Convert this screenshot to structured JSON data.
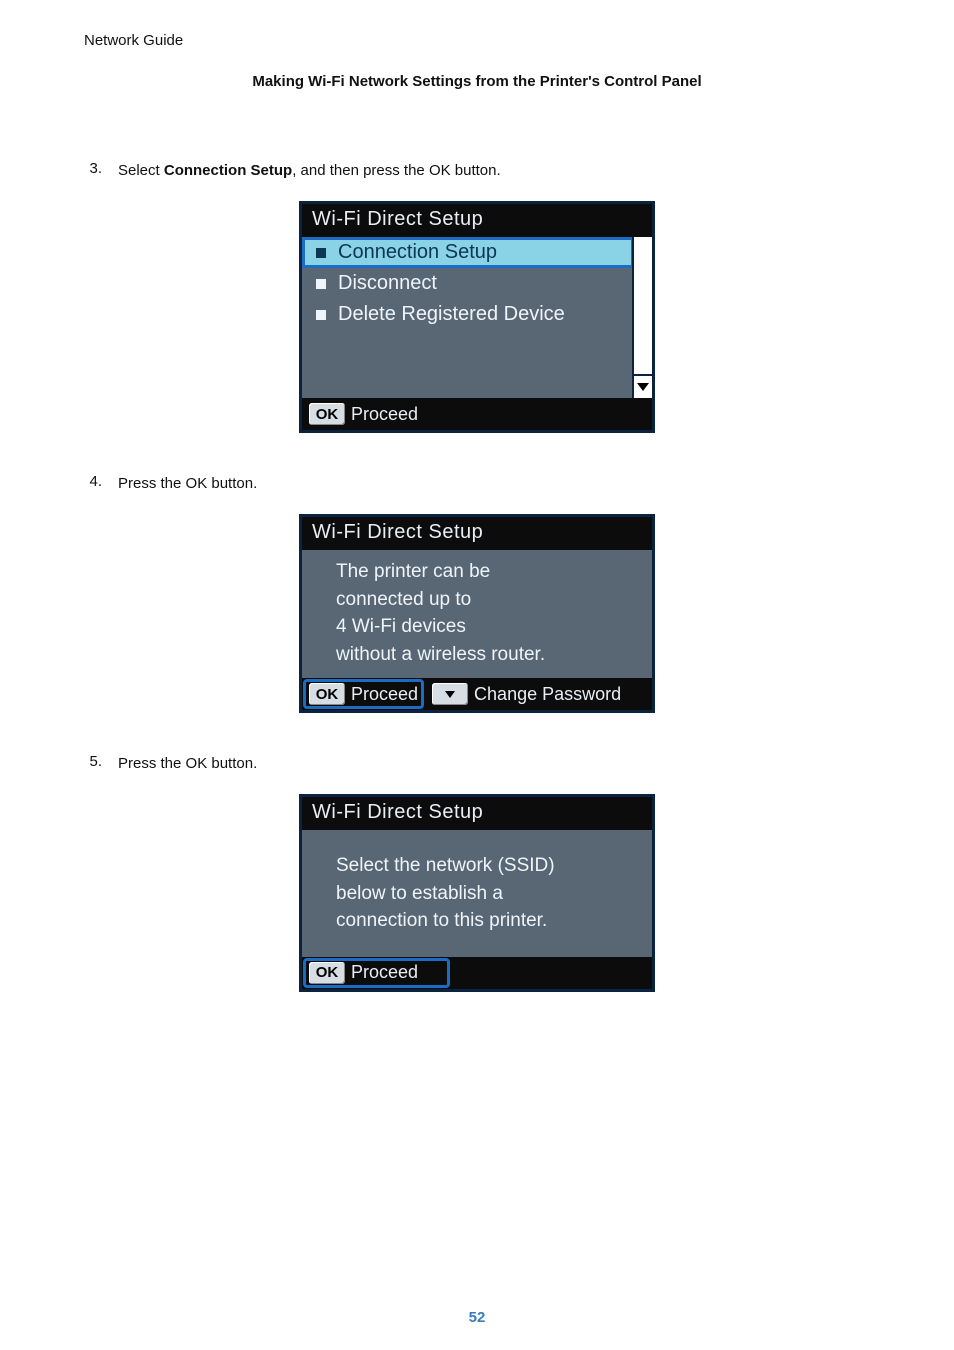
{
  "doc": {
    "title": "Network Guide",
    "section_header": "Making Wi-Fi Network Settings from the Printer's Control Panel",
    "page_number": "52"
  },
  "steps": [
    {
      "number": "3.",
      "pre_text": "Select ",
      "bold_text": "Connection Setup",
      "post_text": ", and then press the OK button."
    },
    {
      "number": "4.",
      "pre_text": "Press the OK button.",
      "bold_text": "",
      "post_text": ""
    },
    {
      "number": "5.",
      "pre_text": "Press the OK button.",
      "bold_text": "",
      "post_text": ""
    }
  ],
  "screens": {
    "s1": {
      "title": "Wi-Fi Direct Setup",
      "items": [
        "Connection Setup",
        "Disconnect",
        "Delete Registered Device"
      ],
      "footer": {
        "ok_label": "OK",
        "ok_text": "Proceed"
      }
    },
    "s2": {
      "title": "Wi-Fi Direct Setup",
      "lines": [
        "The printer can be",
        "connected up to",
        "4 Wi-Fi devices",
        "without a wireless router."
      ],
      "footer": {
        "ok_label": "OK",
        "ok_text": "Proceed",
        "alt_text": "Change Password"
      }
    },
    "s3": {
      "title": "Wi-Fi Direct Setup",
      "lines": [
        "Select the network (SSID)",
        "below to establish a",
        "connection to this printer."
      ],
      "footer": {
        "ok_label": "OK",
        "ok_text": "Proceed"
      }
    }
  }
}
